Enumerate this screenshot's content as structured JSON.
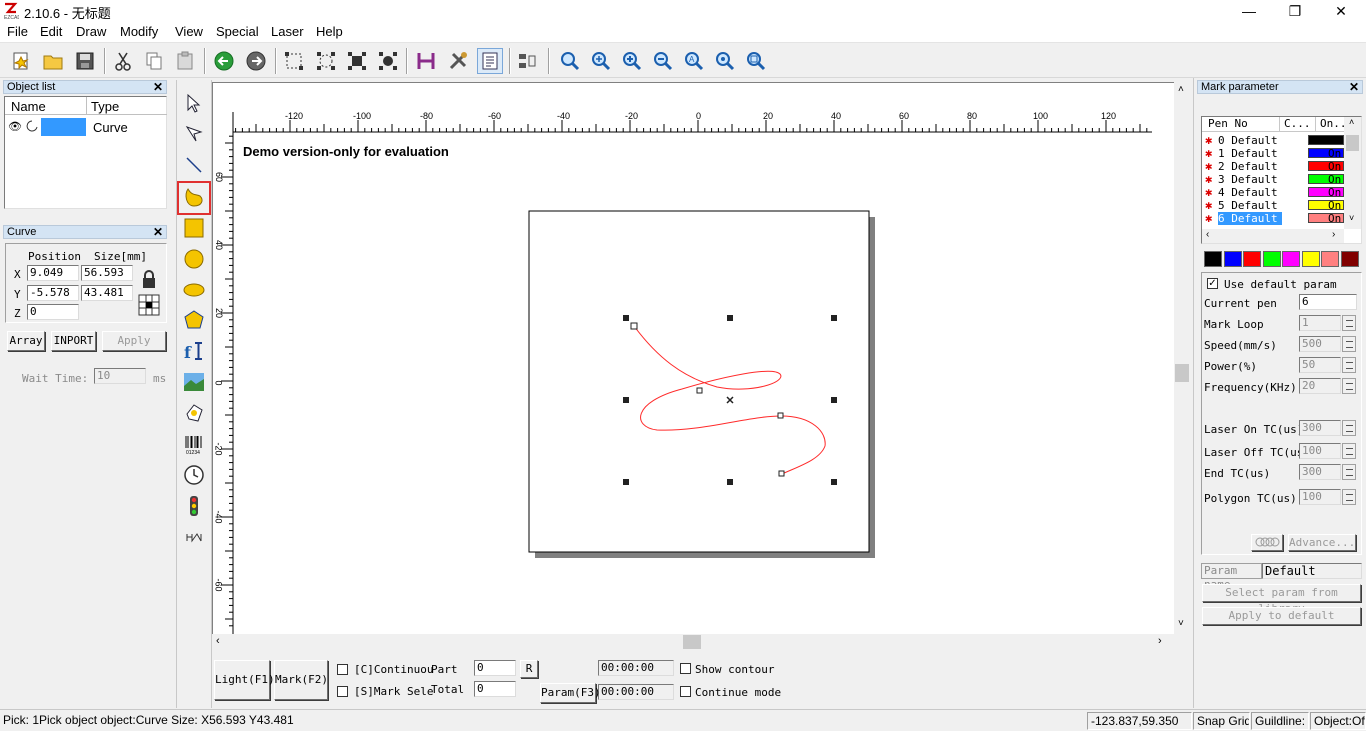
{
  "title_bar": {
    "version": "2.10.6",
    "separator": " - ",
    "doc_name": "无标题"
  },
  "window_buttons": {
    "minimize": "—",
    "restore": "❐",
    "close": "✕"
  },
  "menu": [
    "File",
    "Edit",
    "Draw",
    "Modify",
    "View",
    "Special",
    "Laser",
    "Help"
  ],
  "toolbar_icons": [
    "new-file",
    "open-folder",
    "save",
    "cut",
    "copy",
    "paste",
    "back",
    "forward",
    "select-1",
    "select-2",
    "select-3",
    "select-4",
    "hatch",
    "tools",
    "param-list",
    "align",
    "zoom-out",
    "zoom-in",
    "zoom-in-2",
    "zoom-out-2",
    "zoom-all",
    "zoom-fit",
    "zoom-select"
  ],
  "object_list": {
    "title": "Object list",
    "col_name": "Name",
    "col_type": "Type",
    "rows": [
      {
        "name": "",
        "type": "Curve"
      }
    ]
  },
  "property": {
    "title": "Curve",
    "position_header": "Position",
    "size_header": "Size[mm]",
    "x_label": "X",
    "y_label": "Y",
    "z_label": "Z",
    "x_pos": "9.049",
    "y_pos": "-5.578",
    "z_pos": "0",
    "x_size": "56.593",
    "y_size": "43.481",
    "array_btn": "Array",
    "import_btn": "INPORT",
    "apply_btn": "Apply",
    "wait_label": "Wait Time:",
    "wait_value": "10",
    "wait_unit": "ms"
  },
  "canvas": {
    "demo_text": "Demo version-only for evaluation",
    "h_ticks": [
      "-120",
      "-100",
      "-80",
      "-60",
      "-40",
      "-20",
      "0",
      "20",
      "40",
      "60",
      "80",
      "100",
      "120"
    ],
    "v_ticks": [
      "60",
      "40",
      "20",
      "0",
      "-20",
      "-40",
      "-60"
    ]
  },
  "bottom_bar": {
    "light_btn": "Light(F1)",
    "mark_btn": "Mark(F2)",
    "continuous_label": "[C]Continuou",
    "mark_select_label": "[S]Mark Sele",
    "part_label": "Part",
    "total_label": "Total",
    "part_value": "0",
    "total_value": "0",
    "r_btn": "R",
    "param_btn": "Param(F3)",
    "time1": "00:00:00",
    "time2": "00:00:00",
    "show_contour": "Show contour",
    "continue_mode": "Continue mode"
  },
  "mark_param": {
    "title": "Mark parameter",
    "col_pen": "Pen No",
    "col_color": "C...",
    "col_on": "On...",
    "pens": [
      {
        "label": "0 Default",
        "color": "#000000",
        "on": "On"
      },
      {
        "label": "1 Default",
        "color": "#0000ff",
        "on": "On"
      },
      {
        "label": "2 Default",
        "color": "#ff0000",
        "on": "On"
      },
      {
        "label": "3 Default",
        "color": "#00ff00",
        "on": "On"
      },
      {
        "label": "4 Default",
        "color": "#ff00ff",
        "on": "On"
      },
      {
        "label": "5 Default",
        "color": "#ffff00",
        "on": "On"
      },
      {
        "label": "6 Default",
        "color": "#ff8080",
        "on": "On"
      }
    ],
    "palette": [
      "#000000",
      "#0000ff",
      "#ff0000",
      "#00ff00",
      "#ff00ff",
      "#ffff00",
      "#ff8080",
      "#800000"
    ],
    "use_default": "Use default param",
    "current_pen_label": "Current pen",
    "current_pen": "6",
    "mark_loop_label": "Mark Loop",
    "mark_loop": "1",
    "speed_label": "Speed(mm/s)",
    "speed": "500",
    "power_label": "Power(%)",
    "power": "50",
    "freq_label": "Frequency(KHz)",
    "freq": "20",
    "laser_on_label": "Laser On TC(us)",
    "laser_on": "300",
    "laser_off_label": "Laser Off TC(us",
    "laser_off": "100",
    "end_tc_label": "End TC(us)",
    "end_tc": "300",
    "polygon_label": "Polygon TC(us)",
    "polygon": "100",
    "advance_btn": "Advance...",
    "param_name_label": "Param name",
    "param_name": "Default",
    "select_lib_btn": "Select param from library",
    "apply_default_btn": "Apply to default"
  },
  "status_bar": {
    "message": "Pick: 1Pick object object:Curve Size: X56.593 Y43.481",
    "coords": "-123.837,59.350",
    "snap": "Snap Grid",
    "guideline": "Guildline:",
    "object": "Object:Off"
  }
}
